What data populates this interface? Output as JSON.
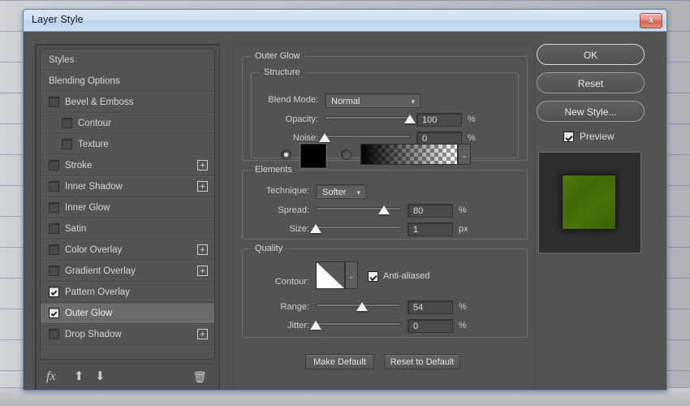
{
  "window": {
    "title": "Layer Style",
    "close_icon": "close-x-icon"
  },
  "styles_panel": {
    "items": [
      {
        "label": "Styles",
        "checkbox": false,
        "indent": false,
        "selected": false,
        "plus": false
      },
      {
        "label": "Blending Options",
        "checkbox": false,
        "indent": false,
        "selected": false,
        "plus": false
      },
      {
        "label": "Bevel & Emboss",
        "checkbox": true,
        "checked": false,
        "indent": false,
        "selected": false,
        "plus": false
      },
      {
        "label": "Contour",
        "checkbox": true,
        "checked": false,
        "indent": true,
        "selected": false,
        "plus": false
      },
      {
        "label": "Texture",
        "checkbox": true,
        "checked": false,
        "indent": true,
        "selected": false,
        "plus": false
      },
      {
        "label": "Stroke",
        "checkbox": true,
        "checked": false,
        "indent": false,
        "selected": false,
        "plus": true
      },
      {
        "label": "Inner Shadow",
        "checkbox": true,
        "checked": false,
        "indent": false,
        "selected": false,
        "plus": true
      },
      {
        "label": "Inner Glow",
        "checkbox": true,
        "checked": false,
        "indent": false,
        "selected": false,
        "plus": false
      },
      {
        "label": "Satin",
        "checkbox": true,
        "checked": false,
        "indent": false,
        "selected": false,
        "plus": false
      },
      {
        "label": "Color Overlay",
        "checkbox": true,
        "checked": false,
        "indent": false,
        "selected": false,
        "plus": true
      },
      {
        "label": "Gradient Overlay",
        "checkbox": true,
        "checked": false,
        "indent": false,
        "selected": false,
        "plus": true
      },
      {
        "label": "Pattern Overlay",
        "checkbox": true,
        "checked": true,
        "indent": false,
        "selected": false,
        "plus": false
      },
      {
        "label": "Outer Glow",
        "checkbox": true,
        "checked": true,
        "indent": false,
        "selected": true,
        "plus": false
      },
      {
        "label": "Drop Shadow",
        "checkbox": true,
        "checked": false,
        "indent": false,
        "selected": false,
        "plus": true
      }
    ],
    "toolbar": {
      "fx": "fx",
      "up_icon": "⬆",
      "down_icon": "⬇",
      "trash_icon": "🗑"
    },
    "plus_glyph": "+"
  },
  "outer_glow": {
    "group_label": "Outer Glow",
    "structure": {
      "legend": "Structure",
      "blend_mode_label": "Blend Mode:",
      "blend_mode_value": "Normal",
      "opacity_label": "Opacity:",
      "opacity_value": "100",
      "opacity_unit": "%",
      "opacity_percent": 100,
      "noise_label": "Noise:",
      "noise_value": "0",
      "noise_unit": "%",
      "noise_percent": 0,
      "color_mode_selected": "solid",
      "color_swatch_hex": "#000000",
      "gradient_caret": "⌄"
    },
    "elements": {
      "legend": "Elements",
      "technique_label": "Technique:",
      "technique_value": "Softer",
      "spread_label": "Spread:",
      "spread_value": "80",
      "spread_unit": "%",
      "spread_percent": 80,
      "size_label": "Size:",
      "size_value": "1",
      "size_unit": "px",
      "size_percent": 0
    },
    "quality": {
      "legend": "Quality",
      "contour_label": "Contour:",
      "contour_caret": "⌄",
      "anti_aliased_label": "Anti-aliased",
      "anti_aliased_checked": true,
      "range_label": "Range:",
      "range_value": "54",
      "range_unit": "%",
      "range_percent": 54,
      "jitter_label": "Jitter:",
      "jitter_value": "0",
      "jitter_unit": "%",
      "jitter_percent": 0
    },
    "make_default_label": "Make Default",
    "reset_default_label": "Reset to Default"
  },
  "actions": {
    "ok_label": "OK",
    "reset_label": "Reset",
    "new_style_label": "New Style...",
    "preview_label": "Preview",
    "preview_checked": true,
    "preview_swatch_color": "#477309"
  }
}
